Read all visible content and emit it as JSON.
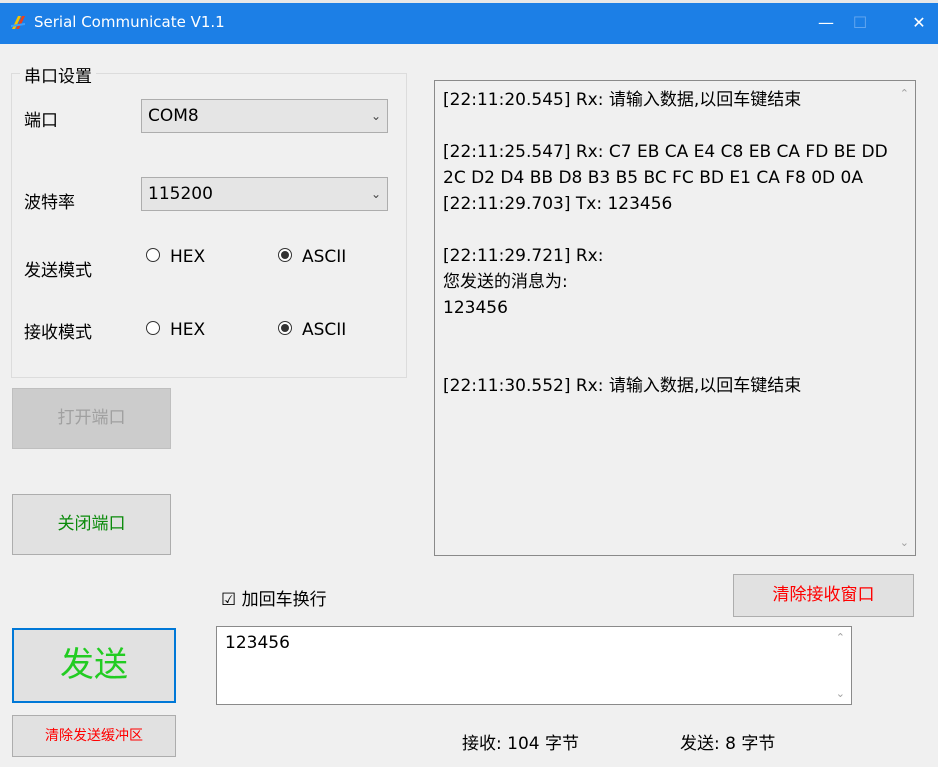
{
  "window": {
    "title": "Serial Communicate V1.1",
    "minimize": "—",
    "maximize": "☐",
    "close": "✕"
  },
  "settings": {
    "group_title": "串口设置",
    "port_label": "端口",
    "port_value": "COM8",
    "baud_label": "波特率",
    "baud_value": "115200",
    "send_mode_label": "发送模式",
    "recv_mode_label": "接收模式",
    "hex": "HEX",
    "ascii": "ASCII"
  },
  "buttons": {
    "open_port": "打开端口",
    "close_port": "关闭端口",
    "send": "发送",
    "clear_send": "清除发送缓冲区",
    "clear_recv": "清除接收窗口"
  },
  "receive": {
    "text": "[22:11:20.545] Rx: 请输入数据,以回车键结束\n\n[22:11:25.547] Rx: C7 EB CA E4 C8 EB CA FD BE DD 2C D2 D4 BB D8 B3 B5 BC FC BD E1 CA F8 0D 0A\n[22:11:29.703] Tx: 123456\n\n[22:11:29.721] Rx:\n您发送的消息为:\n123456\n\n\n[22:11:30.552] Rx: 请输入数据,以回车键结束"
  },
  "send_box": {
    "add_crlf_label": "加回车换行",
    "add_crlf_checked": true,
    "text": "123456"
  },
  "status": {
    "received": "接收: 104 字节",
    "sent": "发送: 8 字节"
  },
  "colors": {
    "titlebar": "#1c7fe6",
    "close_port_text": "#0a8a0a",
    "send_text": "#22cc22",
    "clear_text": "#ff0000",
    "send_border": "#0078d7"
  }
}
